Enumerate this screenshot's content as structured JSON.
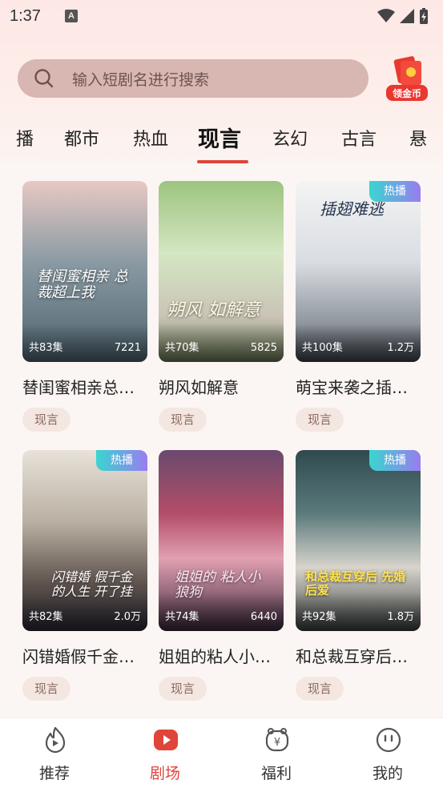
{
  "status_bar": {
    "time": "1:37",
    "notification_letter": "A"
  },
  "search": {
    "placeholder": "输入短剧名进行搜索",
    "coin_label": "领金币"
  },
  "tabs": [
    {
      "label": "播"
    },
    {
      "label": "都市"
    },
    {
      "label": "热血"
    },
    {
      "label": "现言",
      "active": true
    },
    {
      "label": "玄幻"
    },
    {
      "label": "古言"
    },
    {
      "label": "悬"
    }
  ],
  "cards": [
    {
      "title": "替闺蜜相亲总…",
      "episodes": "共83集",
      "views": "7221",
      "tag": "现言",
      "hot": false,
      "poster_text": "替闺蜜相亲 总裁超上我"
    },
    {
      "title": "朔风如解意",
      "episodes": "共70集",
      "views": "5825",
      "tag": "现言",
      "hot": false,
      "poster_text": "朔风 如解意"
    },
    {
      "title": "萌宝来袭之插…",
      "episodes": "共100集",
      "views": "1.2万",
      "tag": "现言",
      "hot": true,
      "hot_label": "热播",
      "poster_text": "插翅难逃"
    },
    {
      "title": "闪错婚假千金…",
      "episodes": "共82集",
      "views": "2.0万",
      "tag": "现言",
      "hot": true,
      "hot_label": "热播",
      "poster_text": "闪错婚 假千金的人生 开了挂"
    },
    {
      "title": "姐姐的粘人小…",
      "episodes": "共74集",
      "views": "6440",
      "tag": "现言",
      "hot": false,
      "poster_text": "姐姐的 粘人小狼狗"
    },
    {
      "title": "和总裁互穿后…",
      "episodes": "共92集",
      "views": "1.8万",
      "tag": "现言",
      "hot": true,
      "hot_label": "热播",
      "poster_text": "和总裁互穿后 先婚后爱"
    }
  ],
  "bottom_nav": [
    {
      "label": "推荐",
      "icon": "flame-play-icon",
      "active": false
    },
    {
      "label": "剧场",
      "icon": "theater-play-icon",
      "active": true
    },
    {
      "label": "福利",
      "icon": "piggy-bank-icon",
      "active": false
    },
    {
      "label": "我的",
      "icon": "smiley-face-icon",
      "active": false
    }
  ],
  "colors": {
    "accent": "#e0453a",
    "search_bg": "#d8b6b2",
    "hot_gradient_start": "#39d6d0",
    "hot_gradient_end": "#9a7cf0"
  }
}
